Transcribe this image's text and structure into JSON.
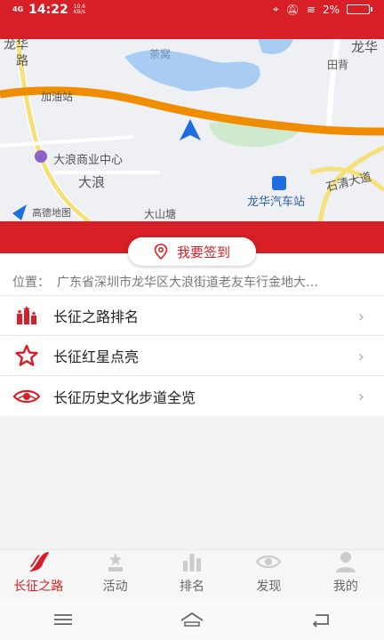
{
  "status": {
    "network": "4G",
    "time": "14:22",
    "speed_value": "10.6",
    "speed_unit": "KB/s",
    "battery": "2%"
  },
  "map": {
    "labels": [
      "龙华",
      "茶窝",
      "田背",
      "加油站",
      "大浪商业中心",
      "大浪",
      "石清大道",
      "龙华汽车站",
      "大山塘",
      "高德地图",
      "龙华",
      "路"
    ]
  },
  "checkin": {
    "label": "我要签到"
  },
  "location": {
    "label": "位置：",
    "value": "广东省深圳市龙华区大浪街道老友车行金地大…"
  },
  "menu": {
    "items": [
      {
        "label": "长征之路排名",
        "icon": "ranking-icon"
      },
      {
        "label": "长征红星点亮",
        "icon": "star-icon"
      },
      {
        "label": "长征历史文化步道全览",
        "icon": "eye-icon"
      }
    ]
  },
  "tabs": [
    {
      "label": "长征之路",
      "active": true
    },
    {
      "label": "活动",
      "active": false
    },
    {
      "label": "排名",
      "active": false
    },
    {
      "label": "发现",
      "active": false
    },
    {
      "label": "我的",
      "active": false
    }
  ],
  "colors": {
    "brand": "#d81e26",
    "route": "#f08c00"
  }
}
